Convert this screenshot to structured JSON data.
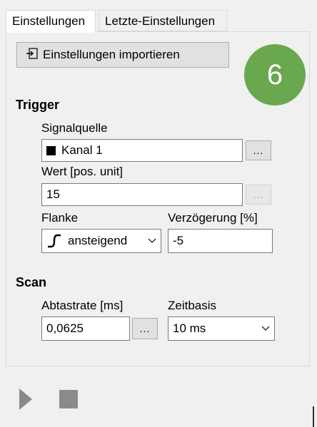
{
  "tabs": [
    {
      "label": "Einstellungen",
      "active": true
    },
    {
      "label": "Letzte-Einstellungen",
      "active": false
    }
  ],
  "import_button": {
    "label": "Einstellungen importieren",
    "icon": "import-icon"
  },
  "badge": {
    "number": "6",
    "color": "#6aa84f"
  },
  "trigger": {
    "heading": "Trigger",
    "signal_source": {
      "label": "Signalquelle",
      "value": "Kanal 1",
      "browse": "..."
    },
    "value": {
      "label": "Wert [pos. unit]",
      "value": "15",
      "browse": "..."
    },
    "edge": {
      "label": "Flanke",
      "value": "ansteigend",
      "icon": "rising-edge-icon"
    },
    "delay": {
      "label": "Verzögerung [%]",
      "value": "-5"
    }
  },
  "scan": {
    "heading": "Scan",
    "sample_rate": {
      "label": "Abtastrate [ms]",
      "value": "0,0625",
      "browse": "..."
    },
    "timebase": {
      "label": "Zeitbasis",
      "value": "10 ms"
    }
  },
  "controls": {
    "play_icon": "play-icon",
    "stop_icon": "stop-icon"
  }
}
